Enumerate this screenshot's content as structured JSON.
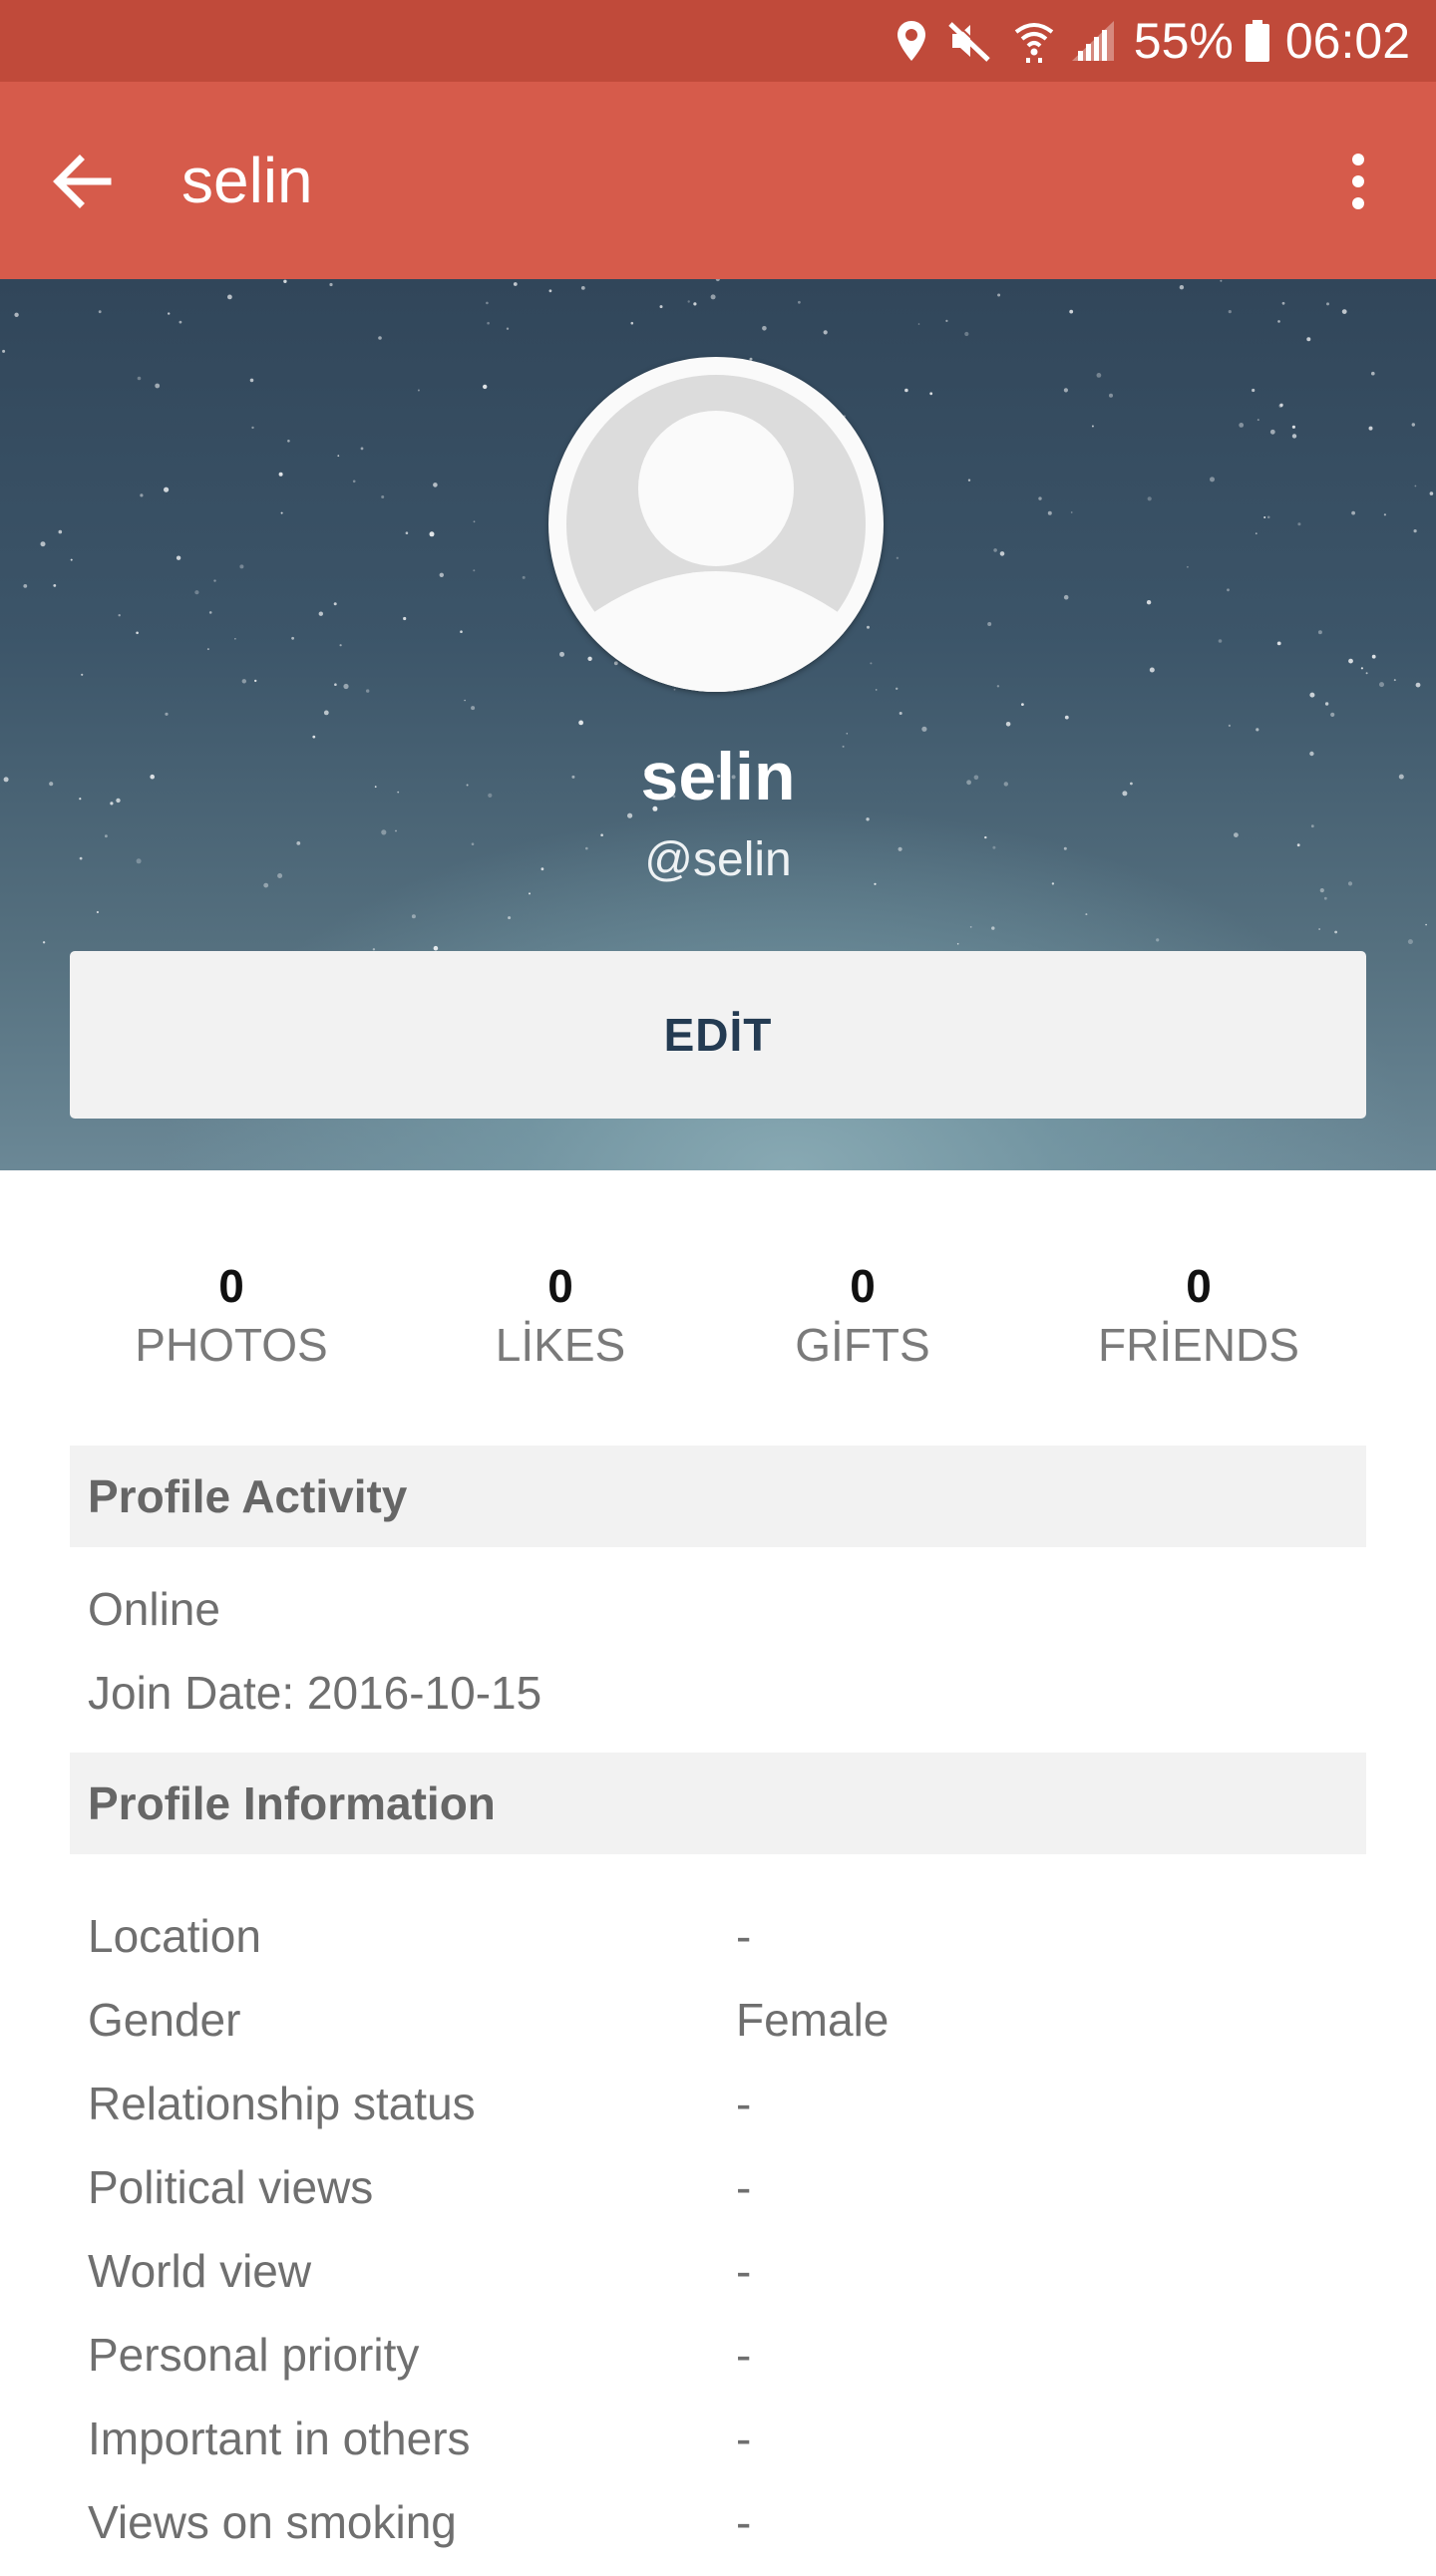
{
  "status_bar": {
    "battery_percent": "55%",
    "time": "06:02",
    "icons": [
      "location-icon",
      "mute-icon",
      "wifi-icon",
      "signal-icon",
      "battery-icon"
    ]
  },
  "app_bar": {
    "title": "selin",
    "back_icon": "arrow-back-icon",
    "menu_icon": "more-vert-icon",
    "background": "#d65b4b",
    "status_background": "#c04a3a"
  },
  "profile": {
    "display_name": "selin",
    "handle": "@selin",
    "edit_label": "EDİT",
    "avatar_icon": "default-avatar-icon"
  },
  "stats": [
    {
      "count": "0",
      "label": "PHOTOS"
    },
    {
      "count": "0",
      "label": "LİKES"
    },
    {
      "count": "0",
      "label": "GİFTS"
    },
    {
      "count": "0",
      "label": "FRİENDS"
    }
  ],
  "activity": {
    "header": "Profile Activity",
    "status": "Online",
    "join_date": "Join Date: 2016-10-15"
  },
  "information": {
    "header": "Profile Information",
    "rows": [
      {
        "label": "Location",
        "value": "-"
      },
      {
        "label": "Gender",
        "value": "Female"
      },
      {
        "label": "Relationship status",
        "value": "-"
      },
      {
        "label": "Political views",
        "value": "-"
      },
      {
        "label": "World view",
        "value": "-"
      },
      {
        "label": "Personal priority",
        "value": "-"
      },
      {
        "label": "Important in others",
        "value": "-"
      },
      {
        "label": "Views on smoking",
        "value": "-"
      }
    ]
  }
}
